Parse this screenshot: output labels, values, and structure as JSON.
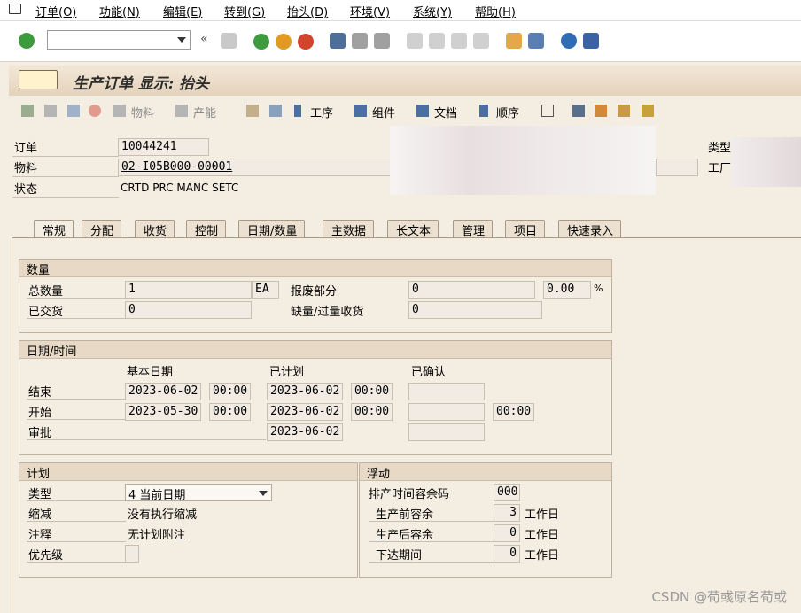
{
  "menu": [
    "订单(O)",
    "功能(N)",
    "编辑(E)",
    "转到(G)",
    "抬头(D)",
    "环境(V)",
    "系统(Y)",
    "帮助(H)"
  ],
  "title": "生产订单 显示: 抬头",
  "app_toolbar": {
    "material": "物料",
    "capacity": "产能",
    "operations": "工序",
    "components": "组件",
    "documents": "文档",
    "sequence": "顺序"
  },
  "header": {
    "order_label": "订单",
    "order_value": "10044241",
    "material_label": "物料",
    "material_value": "02-I05B000-00001",
    "status_label": "状态",
    "status_value": "CRTD PRC  MANC SETC",
    "type_label": "类型",
    "plant_label": "工厂"
  },
  "tabs": [
    "常规",
    "分配",
    "收货",
    "控制",
    "日期/数量",
    "主数据",
    "长文本",
    "管理",
    "项目",
    "快速录入"
  ],
  "quantity": {
    "title": "数量",
    "total_label": "总数量",
    "total_value": "1",
    "unit": "EA",
    "scrap_label": "报废部分",
    "scrap_value": "0",
    "scrap_pct": "0.00",
    "pct_sign": "%",
    "delivered_label": "已交货",
    "delivered_value": "0",
    "short_over_label": "缺量/过量收货",
    "short_over_value": "0"
  },
  "dates": {
    "title": "日期/时间",
    "col_basic": "基本日期",
    "col_scheduled": "已计划",
    "col_confirmed": "已确认",
    "end_label": "结束",
    "end_basic_date": "2023-06-02",
    "end_basic_time": "00:00",
    "end_sched_date": "2023-06-02",
    "end_sched_time": "00:00",
    "start_label": "开始",
    "start_basic_date": "2023-05-30",
    "start_basic_time": "00:00",
    "start_sched_date": "2023-06-02",
    "start_sched_time": "00:00",
    "start_conf_time": "00:00",
    "release_label": "审批",
    "release_sched_date": "2023-06-02"
  },
  "planning": {
    "title": "计划",
    "type_label": "类型",
    "type_value": "4 当前日期",
    "reduction_label": "缩减",
    "reduction_value": "没有执行缩减",
    "note_label": "注释",
    "note_value": "无计划附注",
    "priority_label": "优先级"
  },
  "float": {
    "title": "浮动",
    "sm_key_label": "排产时间容余码",
    "sm_key_value": "000",
    "before_label": "生产前容余",
    "before_value": "3",
    "after_label": "生产后容余",
    "after_value": "0",
    "release_label": "下达期间",
    "release_value": "0",
    "unit": "工作日"
  },
  "watermark": "CSDN @荀彧原名荀或"
}
